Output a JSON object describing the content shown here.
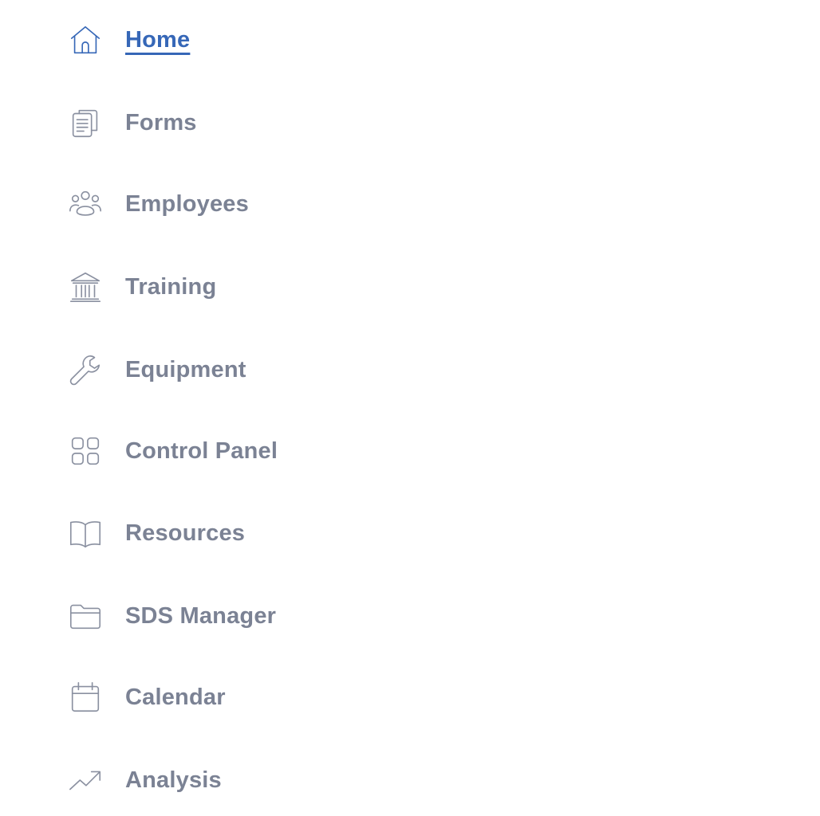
{
  "colors": {
    "active": "#3667b7",
    "inactive_text": "#7b8294",
    "inactive_icon": "#8a90a0",
    "background": "#ffffff"
  },
  "nav": {
    "items": [
      {
        "label": "Home",
        "icon": "home-icon",
        "active": true
      },
      {
        "label": "Forms",
        "icon": "clipboard-icon",
        "active": false
      },
      {
        "label": "Employees",
        "icon": "users-icon",
        "active": false
      },
      {
        "label": "Training",
        "icon": "bank-icon",
        "active": false
      },
      {
        "label": "Equipment",
        "icon": "wrench-icon",
        "active": false
      },
      {
        "label": "Control Panel",
        "icon": "grid-icon",
        "active": false
      },
      {
        "label": "Resources",
        "icon": "book-icon",
        "active": false
      },
      {
        "label": "SDS Manager",
        "icon": "folder-icon",
        "active": false
      },
      {
        "label": "Calendar",
        "icon": "calendar-icon",
        "active": false
      },
      {
        "label": "Analysis",
        "icon": "trending-up-icon",
        "active": false
      }
    ]
  }
}
